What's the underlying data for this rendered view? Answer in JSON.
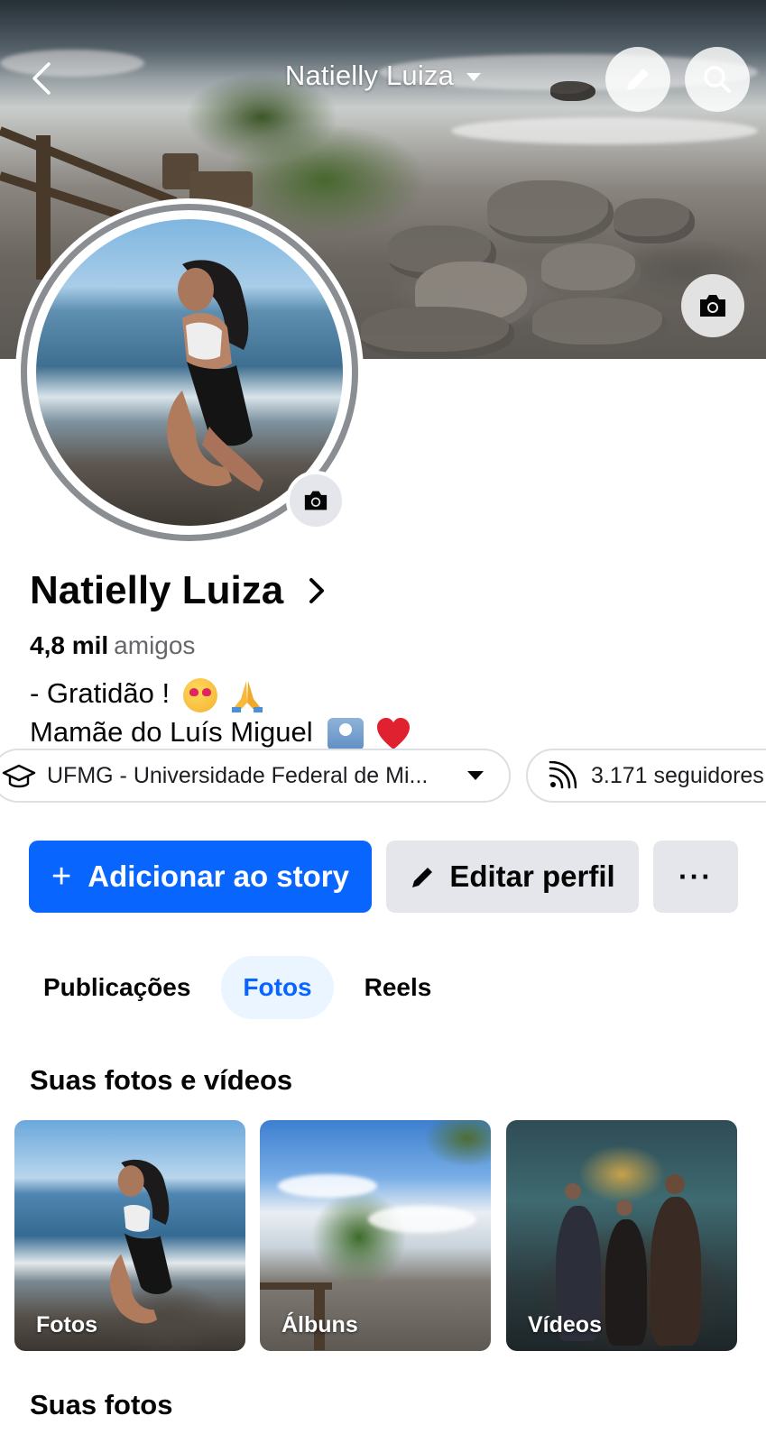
{
  "header": {
    "title": "Natielly Luiza",
    "back_icon": "chevron-left-icon",
    "edit_icon": "pencil-icon",
    "search_icon": "search-icon",
    "cover_camera_icon": "camera-icon"
  },
  "profile": {
    "name": "Natielly Luiza",
    "friends_count": "4,8 mil",
    "friends_label": "amigos",
    "bio_line1": "- Gratidão !",
    "bio_line2": "Mamãe do Luís Miguel"
  },
  "chips": {
    "education": "UFMG - Universidade Federal de Mi...",
    "followers": "3.171 seguidores"
  },
  "actions": {
    "add_story": "Adicionar ao story",
    "add_story_prefix": "+",
    "edit_profile": "Editar perfil",
    "more": "···"
  },
  "tabs": [
    {
      "label": "Publicações",
      "active": false
    },
    {
      "label": "Fotos",
      "active": true
    },
    {
      "label": "Reels",
      "active": false
    }
  ],
  "photos_section": {
    "title": "Suas fotos e vídeos",
    "items": [
      {
        "label": "Fotos"
      },
      {
        "label": "Álbuns"
      },
      {
        "label": "Vídeos"
      }
    ]
  },
  "your_photos": {
    "title": "Suas fotos"
  },
  "colors": {
    "primary": "#0866ff",
    "secondary_button": "#e4e6eb",
    "active_tab_bg": "#ebf5ff",
    "muted_text": "#65676b"
  }
}
